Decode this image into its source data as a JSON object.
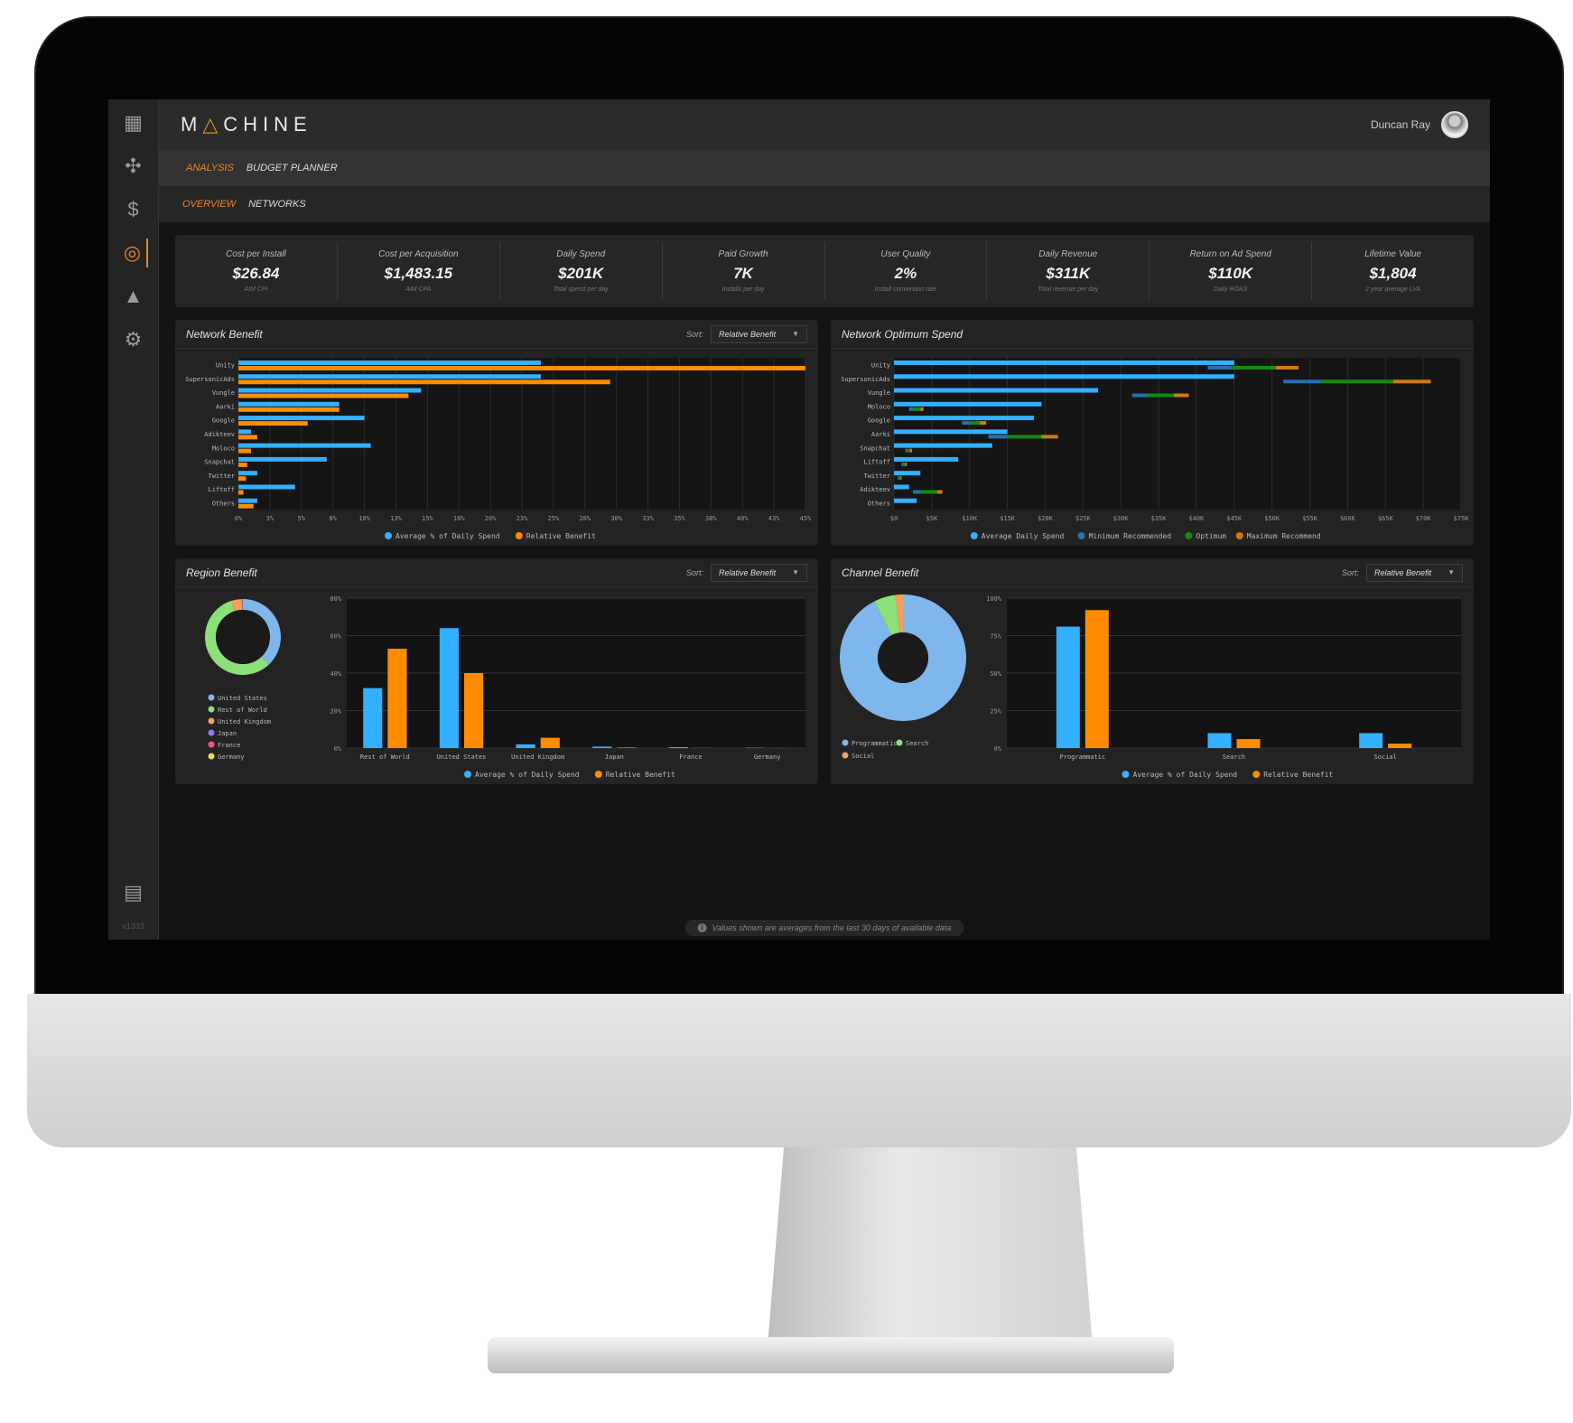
{
  "app": {
    "logo_pre": "M",
    "logo_tri": "△",
    "logo_post": "CHINE",
    "user_name": "Duncan Ray",
    "version": "v1333"
  },
  "sidebar": {
    "items": [
      {
        "icon": "dashboard-icon",
        "glyph": "▦",
        "active": false
      },
      {
        "icon": "network-icon",
        "glyph": "✣",
        "active": false
      },
      {
        "icon": "money-bag-icon",
        "glyph": "$",
        "active": false
      },
      {
        "icon": "target-icon",
        "glyph": "◎",
        "active": true
      },
      {
        "icon": "growth-chart-icon",
        "glyph": "▲",
        "active": false
      },
      {
        "icon": "settings-icon",
        "glyph": "⚙",
        "active": false
      }
    ],
    "bottom_icon": {
      "icon": "building-icon",
      "glyph": "▤"
    }
  },
  "nav": {
    "primary": [
      {
        "label": "Analysis",
        "active": true
      },
      {
        "label": "Budget Planner",
        "active": false
      }
    ],
    "secondary": [
      {
        "label": "Overview",
        "active": true
      },
      {
        "label": "Networks",
        "active": false
      }
    ]
  },
  "kpis": [
    {
      "label": "Cost per Install",
      "value": "$26.84",
      "sub": "AIM CPI"
    },
    {
      "label": "Cost per Acquisition",
      "value": "$1,483.15",
      "sub": "AIM CPA"
    },
    {
      "label": "Daily Spend",
      "value": "$201K",
      "sub": "Total spend per day"
    },
    {
      "label": "Paid Growth",
      "value": "7K",
      "sub": "Installs per day"
    },
    {
      "label": "User Quality",
      "value": "2%",
      "sub": "Install conversion rate"
    },
    {
      "label": "Daily Revenue",
      "value": "$311K",
      "sub": "Total revenue per day"
    },
    {
      "label": "Return on Ad Spend",
      "value": "$110K",
      "sub": "Daily ROAS"
    },
    {
      "label": "Lifetime Value",
      "value": "$1,804",
      "sub": "2 year average LVA"
    }
  ],
  "colors": {
    "blue": "#33b0ff",
    "orange": "#ff8c00",
    "dark_blue": "#2a6fb0",
    "green": "#138a13",
    "amber": "#d07a15",
    "pie_blue": "#7fb6ec",
    "pie_green": "#8be07a",
    "pie_orange": "#f4a15d",
    "pie_purple": "#8b7fe6",
    "pie_pink": "#ee5b7f",
    "pie_yellow": "#efd85a"
  },
  "panels": {
    "network_benefit": {
      "title": "Network Benefit",
      "sort_label": "Sort:",
      "sort_value": "Relative Benefit"
    },
    "network_optimum": {
      "title": "Network Optimum Spend"
    },
    "region_benefit": {
      "title": "Region Benefit",
      "sort_label": "Sort:",
      "sort_value": "Relative Benefit"
    },
    "channel_benefit": {
      "title": "Channel Benefit",
      "sort_label": "Sort:",
      "sort_value": "Relative Benefit"
    }
  },
  "footnote": "Values shown are averages from the last 30 days of available data",
  "chart_data": [
    {
      "id": "network_benefit",
      "type": "bar",
      "orientation": "horizontal",
      "title": "Network Benefit",
      "categories": [
        "Unity",
        "SupersonicAds",
        "Vungle",
        "Aarki",
        "Google",
        "Adikteev",
        "Moloco",
        "Snapchat",
        "Twitter",
        "Liftoff",
        "Others"
      ],
      "series": [
        {
          "name": "Average % of Daily Spend",
          "values": [
            24,
            24,
            14.5,
            8,
            10,
            1,
            10.5,
            7,
            1.5,
            4.5,
            1.5
          ]
        },
        {
          "name": "Relative Benefit",
          "values": [
            45,
            29.5,
            13.5,
            8,
            5.5,
            1.5,
            1,
            0.7,
            0.6,
            0.4,
            1.2
          ]
        }
      ],
      "xticks": [
        "0%",
        "3%",
        "5%",
        "8%",
        "10%",
        "13%",
        "15%",
        "18%",
        "20%",
        "23%",
        "25%",
        "28%",
        "30%",
        "33%",
        "35%",
        "38%",
        "40%",
        "43%",
        "45%"
      ],
      "xlim": [
        0,
        45
      ],
      "legend": "bottom"
    },
    {
      "id": "network_optimum",
      "type": "bar",
      "orientation": "horizontal",
      "title": "Network Optimum Spend",
      "categories": [
        "Unity",
        "SupersonicAds",
        "Vungle",
        "Moloco",
        "Google",
        "Aarki",
        "Snapchat",
        "Liftoff",
        "Twitter",
        "Adikteev",
        "Others"
      ],
      "series": [
        {
          "name": "Average Daily Spend",
          "values": [
            45000,
            45000,
            27000,
            19500,
            18500,
            15000,
            13000,
            8500,
            3500,
            2000,
            3000
          ]
        },
        {
          "name": "Minimum Recommended",
          "values": [
            41500,
            51500,
            31500,
            2000,
            9000,
            12500,
            1500,
            1000,
            500,
            2500,
            0
          ]
        },
        {
          "name": "Optimum",
          "values": [
            44500,
            56500,
            33500,
            2600,
            10000,
            15000,
            1700,
            1200,
            700,
            3500,
            0
          ]
        },
        {
          "name": "Maximum Recommend",
          "values": [
            50500,
            66000,
            37000,
            3500,
            11400,
            19500,
            2100,
            1500,
            900,
            5700,
            0
          ]
        },
        {
          "name": "Maximum Recommend End",
          "values": [
            53500,
            71000,
            39000,
            3900,
            12200,
            21700,
            2400,
            1700,
            1000,
            6400,
            0
          ]
        }
      ],
      "xticks": [
        "$0",
        "$5K",
        "$10K",
        "$15K",
        "$20K",
        "$25K",
        "$30K",
        "$35K",
        "$40K",
        "$45K",
        "$50K",
        "$55K",
        "$60K",
        "$65K",
        "$70K",
        "$75K"
      ],
      "xlim": [
        0,
        75000
      ],
      "legend": "bottom"
    },
    {
      "id": "region_pie",
      "type": "pie",
      "donut": true,
      "labels": [
        "United States",
        "Rest of World",
        "United Kingdom",
        "Japan",
        "France",
        "Germany"
      ],
      "values": [
        38,
        57,
        4.5,
        0.2,
        0.2,
        0.1
      ],
      "legend": "bottom"
    },
    {
      "id": "region_benefit",
      "type": "bar",
      "title": "Region Benefit",
      "categories": [
        "Rest of World",
        "United States",
        "United Kingdom",
        "Japan",
        "France",
        "Germany"
      ],
      "series": [
        {
          "name": "Average % of Daily Spend",
          "values": [
            32,
            64,
            2,
            0.8,
            0.5,
            0.2
          ]
        },
        {
          "name": "Relative Benefit",
          "values": [
            53,
            40,
            5.5,
            0.3,
            0.1,
            0.05
          ]
        }
      ],
      "yticks": [
        "0%",
        "20%",
        "40%",
        "60%",
        "80%"
      ],
      "ylim": [
        0,
        80
      ],
      "legend": "bottom"
    },
    {
      "id": "channel_pie",
      "type": "pie",
      "donut": true,
      "labels": [
        "Programmatic",
        "Search",
        "Social"
      ],
      "values": [
        92.5,
        5.5,
        2
      ],
      "legend": "bottom"
    },
    {
      "id": "channel_benefit",
      "type": "bar",
      "title": "Channel Benefit",
      "categories": [
        "Programmatic",
        "Search",
        "Social"
      ],
      "series": [
        {
          "name": "Average % of Daily Spend",
          "values": [
            81,
            10,
            10
          ]
        },
        {
          "name": "Relative Benefit",
          "values": [
            92,
            6,
            3
          ]
        }
      ],
      "yticks": [
        "0%",
        "25%",
        "50%",
        "75%",
        "100%"
      ],
      "ylim": [
        0,
        100
      ],
      "legend": "bottom"
    }
  ]
}
